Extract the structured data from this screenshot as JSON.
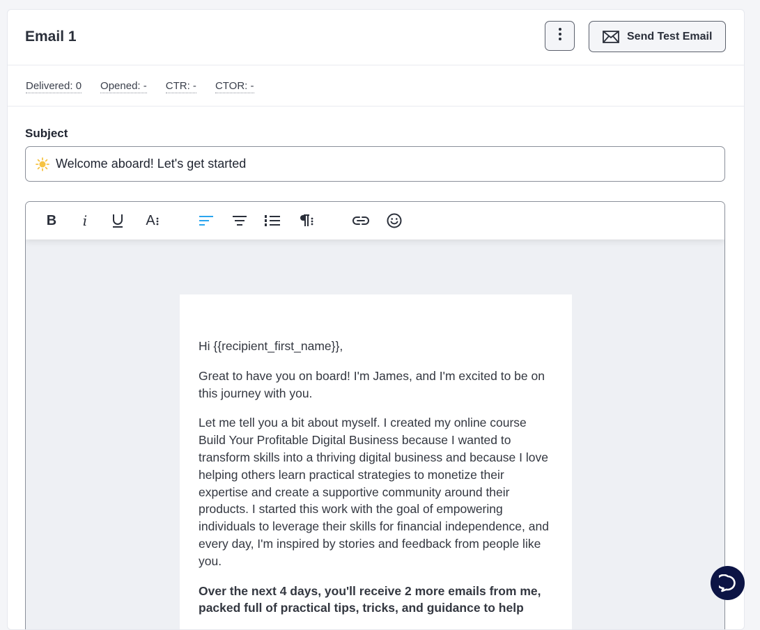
{
  "header": {
    "title": "Email 1",
    "more_icon": "more-vertical-icon",
    "send_test_label": "Send Test Email",
    "send_icon": "envelope-icon"
  },
  "stats": [
    {
      "label": "Delivered: 0"
    },
    {
      "label": "Opened: -"
    },
    {
      "label": "CTR: -"
    },
    {
      "label": "CTOR: -"
    }
  ],
  "subject": {
    "label": "Subject",
    "value": "Welcome aboard! Let's get started",
    "emoji_icon": "sun-icon"
  },
  "toolbar": {
    "tools": [
      "bold-icon",
      "italic-icon",
      "underline-icon",
      "font-size-icon",
      "align-left-icon",
      "align-center-icon",
      "ordered-list-icon",
      "paragraph-format-icon",
      "link-icon",
      "emoji-icon"
    ],
    "active_color": "#2aa5ee",
    "bold_glyph": "B",
    "italic_glyph": "i",
    "underline_glyph": "U",
    "font_glyph": "A"
  },
  "email_body": {
    "greeting": "Hi {{recipient_first_name}},",
    "para1": "Great to have you on board! I'm James, and I'm excited to be on this journey with you.",
    "para2": "Let me tell you a bit about myself. I created my online course Build Your Profitable Digital Business because I wanted to transform skills into a thriving digital business and because I love helping others learn practical strategies to monetize their expertise and create a supportive community around their products. I started this work with the goal of empowering individuals to leverage their skills for financial independence, and every day, I'm inspired by stories and feedback from people like you.",
    "para3": "Over the next 4 days, you'll receive 2 more emails from me, packed full of practical tips, tricks, and guidance to help"
  },
  "chat": {
    "icon": "chat-bubble-icon",
    "color": "#0c1445"
  }
}
